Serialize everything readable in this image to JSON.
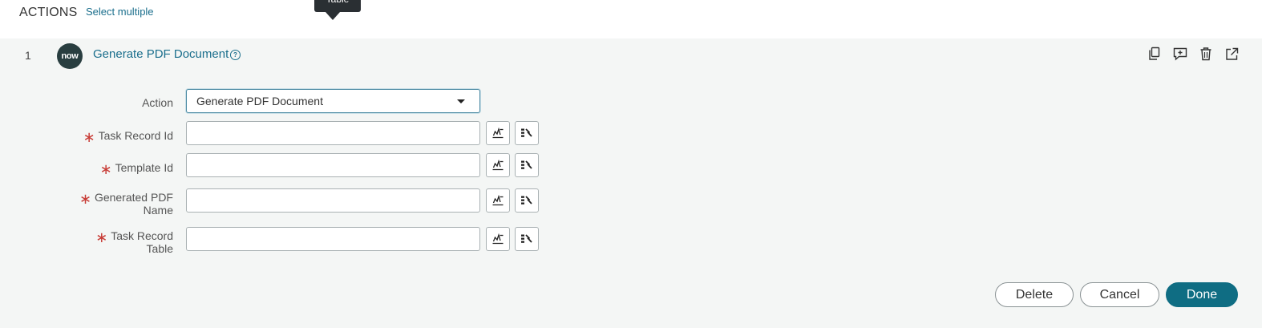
{
  "header": {
    "title": "ACTIONS",
    "select_multiple": "Select multiple"
  },
  "tooltip": {
    "text": "Table"
  },
  "step": {
    "number": "1",
    "logo_text": "now",
    "title": "Generate PDF Document",
    "help_icon_glyph": "?",
    "toolbar_icons": [
      "copy-icon",
      "add-comment-icon",
      "trash-icon",
      "open-external-icon"
    ]
  },
  "form": {
    "action": {
      "label": "Action",
      "value": "Generate PDF Document"
    },
    "fields": [
      {
        "label_lines": [
          "Task Record Id"
        ],
        "value": ""
      },
      {
        "label_lines": [
          "Template Id"
        ],
        "value": ""
      },
      {
        "label_lines": [
          "Generated PDF",
          "Name"
        ],
        "value": ""
      },
      {
        "label_lines": [
          "Task Record",
          "Table"
        ],
        "value": ""
      }
    ],
    "required_marker": "∗"
  },
  "buttons": {
    "delete": "Delete",
    "cancel": "Cancel",
    "done": "Done"
  },
  "colors": {
    "link": "#1a6e8c",
    "primary": "#0f6d83",
    "required": "#c83c36",
    "logo_bg": "#293e40"
  }
}
